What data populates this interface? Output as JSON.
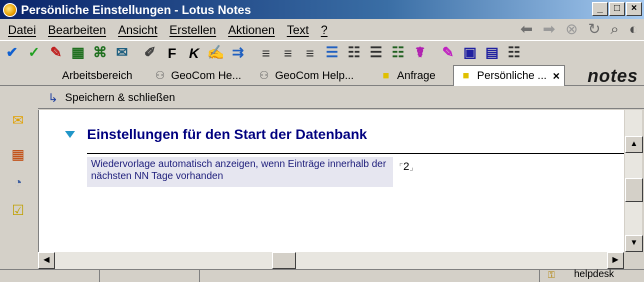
{
  "window": {
    "title": "Persönliche Einstellungen - Lotus Notes",
    "buttons": [
      "_",
      "□",
      "×"
    ]
  },
  "menu": {
    "items": [
      "Datei",
      "Bearbeiten",
      "Ansicht",
      "Erstellen",
      "Aktionen",
      "Text",
      "?"
    ]
  },
  "nav_icons": [
    "back-arrow-icon",
    "forward-arrow-icon",
    "stop-icon",
    "refresh-icon",
    "search-icon",
    "go-icon"
  ],
  "toolbar": {
    "icons": [
      "check-icon",
      "checkmark-icon",
      "highlighter-icon",
      "table-icon",
      "link-icon",
      "attach-icon",
      "paperclip-icon",
      "bold-icon",
      "italic-icon",
      "format-painter-icon",
      "indent-icon",
      "align-left-icon",
      "align-center-icon",
      "align-right-icon",
      "bullet-icon",
      "number-icon",
      "list-icon",
      "spell-icon",
      "color-icon",
      "abc-icon",
      "picture-icon",
      "table-insert-icon"
    ],
    "bold_glyph": "F",
    "italic_glyph": "K"
  },
  "tabs": [
    {
      "label": "Arbeitsbereich",
      "icon": "",
      "active": false
    },
    {
      "label": "GeoCom He...",
      "icon": "database-icon",
      "active": false
    },
    {
      "label": "GeoCom Help...",
      "icon": "database-icon",
      "active": false
    },
    {
      "label": "Anfrage",
      "icon": "document-icon",
      "active": false
    },
    {
      "label": "Persönliche ...",
      "icon": "document-icon",
      "active": true
    }
  ],
  "tab_close": "×",
  "brand": "notes",
  "action_bar": {
    "save_close_label": "Speichern & schließen"
  },
  "document": {
    "section_title": "Einstellungen für den Start der Datenbank",
    "field_label": "Wiedervorlage automatisch anzeigen, wenn Einträge innerhalb der nächsten NN Tage vorhanden",
    "field_value": "2"
  },
  "statusbar": {
    "location": "helpdesk"
  },
  "colors": {
    "title_start": "#0a246a",
    "title_end": "#a6caf0",
    "section_title": "#00007f",
    "field_bg": "#e6e6f0"
  }
}
